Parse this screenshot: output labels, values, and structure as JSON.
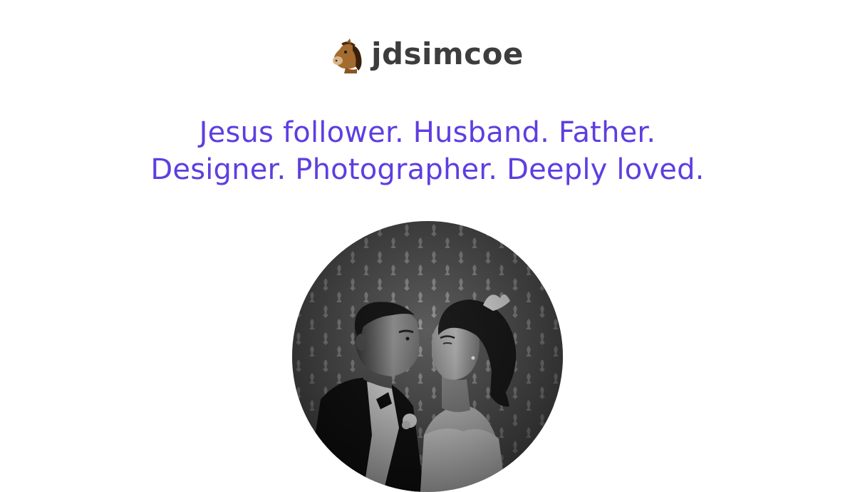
{
  "header": {
    "brand_icon": "horse-face-icon",
    "brand_name": "jdsimcoe"
  },
  "bio": {
    "line1": "Jesus follower. Husband. Father.",
    "line2": "Designer. Photographer. Deeply loved."
  },
  "photo": {
    "description_icon": "wedding-couple-photo",
    "colors": {
      "accent": "#5e3ee0",
      "brand_text": "#3d3d3d"
    }
  }
}
